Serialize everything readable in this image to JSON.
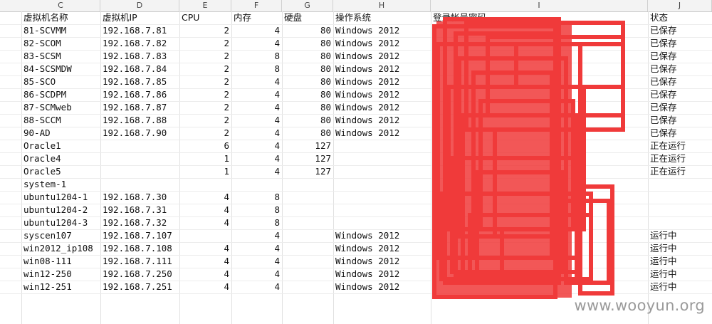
{
  "columns": [
    "C",
    "D",
    "E",
    "F",
    "G",
    "H",
    "I",
    "J"
  ],
  "headers": [
    "虚拟机名称",
    "虚拟机IP",
    "CPU",
    "内存",
    "硬盘",
    "操作系统",
    "登录帐号密码",
    "状态"
  ],
  "rows": [
    [
      "81-SCVMM",
      "192.168.7.81",
      "2",
      "4",
      "80",
      "Windows 2012",
      "已保存"
    ],
    [
      "82-SCOM",
      "192.168.7.82",
      "2",
      "4",
      "80",
      "Windows 2012",
      "已保存"
    ],
    [
      "83-SCSM",
      "192.168.7.83",
      "2",
      "8",
      "80",
      "Windows 2012",
      "已保存"
    ],
    [
      "84-SCSMDW",
      "192.168.7.84",
      "2",
      "8",
      "80",
      "Windows 2012",
      "已保存"
    ],
    [
      "85-SCO",
      "192.168.7.85",
      "2",
      "4",
      "80",
      "Windows 2012",
      "已保存"
    ],
    [
      "86-SCDPM",
      "192.168.7.86",
      "2",
      "4",
      "80",
      "Windows 2012",
      "已保存"
    ],
    [
      "87-SCMweb",
      "192.168.7.87",
      "2",
      "4",
      "80",
      "Windows 2012",
      "已保存"
    ],
    [
      "88-SCCM",
      "192.168.7.88",
      "2",
      "4",
      "80",
      "Windows 2012",
      "已保存"
    ],
    [
      "90-AD",
      "192.168.7.90",
      "2",
      "4",
      "80",
      "Windows 2012",
      "已保存"
    ],
    [
      "Oracle1",
      "",
      "6",
      "4",
      "127",
      "",
      "正在运行"
    ],
    [
      "Oracle4",
      "",
      "1",
      "4",
      "127",
      "",
      "正在运行"
    ],
    [
      "Oracle5",
      "",
      "1",
      "4",
      "127",
      "",
      "正在运行"
    ],
    [
      "system-1",
      "",
      "",
      "",
      "",
      "",
      ""
    ],
    [
      "ubuntu1204-1",
      "192.168.7.30",
      "4",
      "8",
      "",
      "",
      ""
    ],
    [
      "ubuntu1204-2",
      "192.168.7.31",
      "4",
      "8",
      "",
      "",
      ""
    ],
    [
      "ubuntu1204-3",
      "192.168.7.32",
      "4",
      "8",
      "",
      "",
      ""
    ],
    [
      "syscen107",
      "192.168.7.107",
      "",
      "4",
      "",
      "Windows 2012",
      "运行中"
    ],
    [
      "win2012_ip108",
      "192.168.7.108",
      "4",
      "4",
      "",
      "Windows 2012",
      "运行中"
    ],
    [
      "win08-111",
      "192.168.7.111",
      "4",
      "4",
      "",
      "Windows 2012",
      "运行中"
    ],
    [
      "win12-250",
      "192.168.7.250",
      "4",
      "4",
      "",
      "Windows 2012",
      "运行中"
    ],
    [
      "win12-251",
      "192.168.7.251",
      "4",
      "4",
      "",
      "Windows 2012",
      "运行中"
    ]
  ],
  "redaction_color": "#f03a3a",
  "watermark": "www.wooyun.org"
}
